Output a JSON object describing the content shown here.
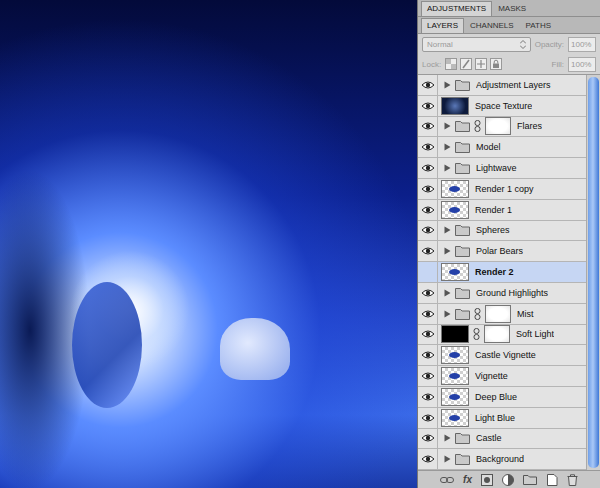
{
  "panel_tabs": [
    {
      "label": "ADJUSTMENTS",
      "selected": true
    },
    {
      "label": "MASKS",
      "selected": false
    }
  ],
  "layer_tabs": [
    {
      "label": "LAYERS",
      "selected": true
    },
    {
      "label": "CHANNELS",
      "selected": false
    },
    {
      "label": "PATHS",
      "selected": false
    }
  ],
  "blend": {
    "value": "Normal",
    "disabled": true
  },
  "opacity": {
    "label": "Opacity:",
    "value": "100%",
    "disabled": true
  },
  "lock": {
    "label": "Lock:",
    "disabled": true
  },
  "fill": {
    "label": "Fill:",
    "value": "100%",
    "disabled": true
  },
  "layers": [
    {
      "name": "Adjustment Layers",
      "kind": "group",
      "visible": true,
      "selected": false,
      "mask": false
    },
    {
      "name": "Space Texture",
      "kind": "texture",
      "visible": true,
      "selected": false,
      "mask": false
    },
    {
      "name": "Flares",
      "kind": "group",
      "visible": true,
      "selected": false,
      "mask": true
    },
    {
      "name": "Model",
      "kind": "group",
      "visible": true,
      "selected": false,
      "mask": false
    },
    {
      "name": "Lightwave",
      "kind": "group",
      "visible": true,
      "selected": false,
      "mask": false
    },
    {
      "name": "Render 1 copy",
      "kind": "layer",
      "visible": true,
      "selected": false,
      "mask": false
    },
    {
      "name": "Render 1",
      "kind": "layer",
      "visible": true,
      "selected": false,
      "mask": false
    },
    {
      "name": "Spheres",
      "kind": "group",
      "visible": true,
      "selected": false,
      "mask": false
    },
    {
      "name": "Polar Bears",
      "kind": "group",
      "visible": true,
      "selected": false,
      "mask": false
    },
    {
      "name": "Render 2",
      "kind": "layer",
      "visible": false,
      "selected": true,
      "mask": false
    },
    {
      "name": "Ground Highlights",
      "kind": "group",
      "visible": true,
      "selected": false,
      "mask": false
    },
    {
      "name": "Mist",
      "kind": "group",
      "visible": true,
      "selected": false,
      "mask": true
    },
    {
      "name": "Soft Light",
      "kind": "fill",
      "visible": true,
      "selected": false,
      "mask": true
    },
    {
      "name": "Castle Vignette",
      "kind": "layer",
      "visible": true,
      "selected": false,
      "mask": false
    },
    {
      "name": "Vignette",
      "kind": "layer",
      "visible": true,
      "selected": false,
      "mask": false
    },
    {
      "name": "Deep Blue",
      "kind": "layer",
      "visible": true,
      "selected": false,
      "mask": false
    },
    {
      "name": "Light Blue",
      "kind": "layer",
      "visible": true,
      "selected": false,
      "mask": false
    },
    {
      "name": "Castle",
      "kind": "group",
      "visible": true,
      "selected": false,
      "mask": false
    },
    {
      "name": "Background",
      "kind": "group",
      "visible": true,
      "selected": false,
      "mask": false
    }
  ],
  "footer": {
    "fx": "fx"
  }
}
